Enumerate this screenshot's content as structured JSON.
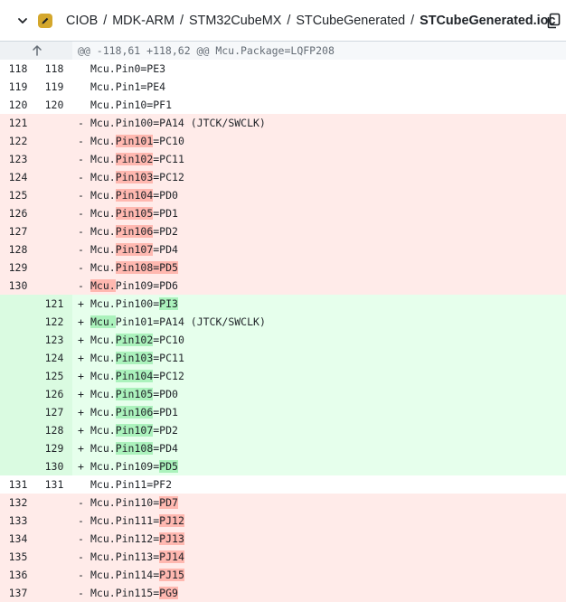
{
  "breadcrumb": {
    "parts": [
      "CIOB",
      "MDK-ARM",
      "STM32CubeMX",
      "STCubeGenerated"
    ],
    "file": "STCubeGenerated.ioc",
    "separator": "/"
  },
  "icons": {
    "collapse": "chevron-down-icon",
    "edit": "pencil-icon",
    "copy": "copy-icon",
    "expand": "arrow-up-icon"
  },
  "colors": {
    "del_bg": "#ffebe9",
    "del_word": "#ffb8b0",
    "add_bg": "#e6ffec",
    "add_word": "#abf2bc",
    "badge": "#d4a72c"
  },
  "hunk": "@@ -118,61 +118,62 @@ Mcu.Package=LQFP208",
  "lines": [
    {
      "type": "ctx",
      "old": "118",
      "new": "118",
      "sign": "",
      "pre": "Mcu.Pin0=PE3",
      "hl": "",
      "post": ""
    },
    {
      "type": "ctx",
      "old": "119",
      "new": "119",
      "sign": "",
      "pre": "Mcu.Pin1=PE4",
      "hl": "",
      "post": ""
    },
    {
      "type": "ctx",
      "old": "120",
      "new": "120",
      "sign": "",
      "pre": "Mcu.Pin10=PF1",
      "hl": "",
      "post": ""
    },
    {
      "type": "del",
      "old": "121",
      "new": "",
      "sign": "-",
      "pre": "Mcu.Pin100=PA14 (JTCK/SWCLK)",
      "hl": "",
      "post": ""
    },
    {
      "type": "del",
      "old": "122",
      "new": "",
      "sign": "-",
      "pre": "Mcu.",
      "hl": "Pin101",
      "post": "=PC10"
    },
    {
      "type": "del",
      "old": "123",
      "new": "",
      "sign": "-",
      "pre": "Mcu.",
      "hl": "Pin102",
      "post": "=PC11"
    },
    {
      "type": "del",
      "old": "124",
      "new": "",
      "sign": "-",
      "pre": "Mcu.",
      "hl": "Pin103",
      "post": "=PC12"
    },
    {
      "type": "del",
      "old": "125",
      "new": "",
      "sign": "-",
      "pre": "Mcu.",
      "hl": "Pin104",
      "post": "=PD0"
    },
    {
      "type": "del",
      "old": "126",
      "new": "",
      "sign": "-",
      "pre": "Mcu.",
      "hl": "Pin105",
      "post": "=PD1"
    },
    {
      "type": "del",
      "old": "127",
      "new": "",
      "sign": "-",
      "pre": "Mcu.",
      "hl": "Pin106",
      "post": "=PD2"
    },
    {
      "type": "del",
      "old": "128",
      "new": "",
      "sign": "-",
      "pre": "Mcu.",
      "hl": "Pin107",
      "post": "=PD4"
    },
    {
      "type": "del",
      "old": "129",
      "new": "",
      "sign": "-",
      "pre": "Mcu.",
      "hl": "Pin108=PD5",
      "post": ""
    },
    {
      "type": "del",
      "old": "130",
      "new": "",
      "sign": "-",
      "pre": "",
      "hl": "Mcu.",
      "post": "Pin109=PD6"
    },
    {
      "type": "add",
      "old": "",
      "new": "121",
      "sign": "+",
      "pre": "Mcu.Pin100=",
      "hl": "PI3",
      "post": ""
    },
    {
      "type": "add",
      "old": "",
      "new": "122",
      "sign": "+",
      "pre": "",
      "hl": "Mcu.",
      "post": "Pin101=PA14 (JTCK/SWCLK)"
    },
    {
      "type": "add",
      "old": "",
      "new": "123",
      "sign": "+",
      "pre": "Mcu.",
      "hl": "Pin102",
      "post": "=PC10"
    },
    {
      "type": "add",
      "old": "",
      "new": "124",
      "sign": "+",
      "pre": "Mcu.",
      "hl": "Pin103",
      "post": "=PC11"
    },
    {
      "type": "add",
      "old": "",
      "new": "125",
      "sign": "+",
      "pre": "Mcu.",
      "hl": "Pin104",
      "post": "=PC12"
    },
    {
      "type": "add",
      "old": "",
      "new": "126",
      "sign": "+",
      "pre": "Mcu.",
      "hl": "Pin105",
      "post": "=PD0"
    },
    {
      "type": "add",
      "old": "",
      "new": "127",
      "sign": "+",
      "pre": "Mcu.",
      "hl": "Pin106",
      "post": "=PD1"
    },
    {
      "type": "add",
      "old": "",
      "new": "128",
      "sign": "+",
      "pre": "Mcu.",
      "hl": "Pin107",
      "post": "=PD2"
    },
    {
      "type": "add",
      "old": "",
      "new": "129",
      "sign": "+",
      "pre": "Mcu.",
      "hl": "Pin108",
      "post": "=PD4"
    },
    {
      "type": "add",
      "old": "",
      "new": "130",
      "sign": "+",
      "pre": "Mcu.Pin109=",
      "hl": "PD5",
      "post": ""
    },
    {
      "type": "ctx",
      "old": "131",
      "new": "131",
      "sign": "",
      "pre": "Mcu.Pin11=PF2",
      "hl": "",
      "post": ""
    },
    {
      "type": "del",
      "old": "132",
      "new": "",
      "sign": "-",
      "pre": "Mcu.Pin110=",
      "hl": "PD7",
      "post": ""
    },
    {
      "type": "del",
      "old": "133",
      "new": "",
      "sign": "-",
      "pre": "Mcu.Pin111=",
      "hl": "PJ12",
      "post": ""
    },
    {
      "type": "del",
      "old": "134",
      "new": "",
      "sign": "-",
      "pre": "Mcu.Pin112=",
      "hl": "PJ13",
      "post": ""
    },
    {
      "type": "del",
      "old": "135",
      "new": "",
      "sign": "-",
      "pre": "Mcu.Pin113=",
      "hl": "PJ14",
      "post": ""
    },
    {
      "type": "del",
      "old": "136",
      "new": "",
      "sign": "-",
      "pre": "Mcu.Pin114=",
      "hl": "PJ15",
      "post": ""
    },
    {
      "type": "del",
      "old": "137",
      "new": "",
      "sign": "-",
      "pre": "Mcu.Pin115=",
      "hl": "PG9",
      "post": ""
    }
  ]
}
